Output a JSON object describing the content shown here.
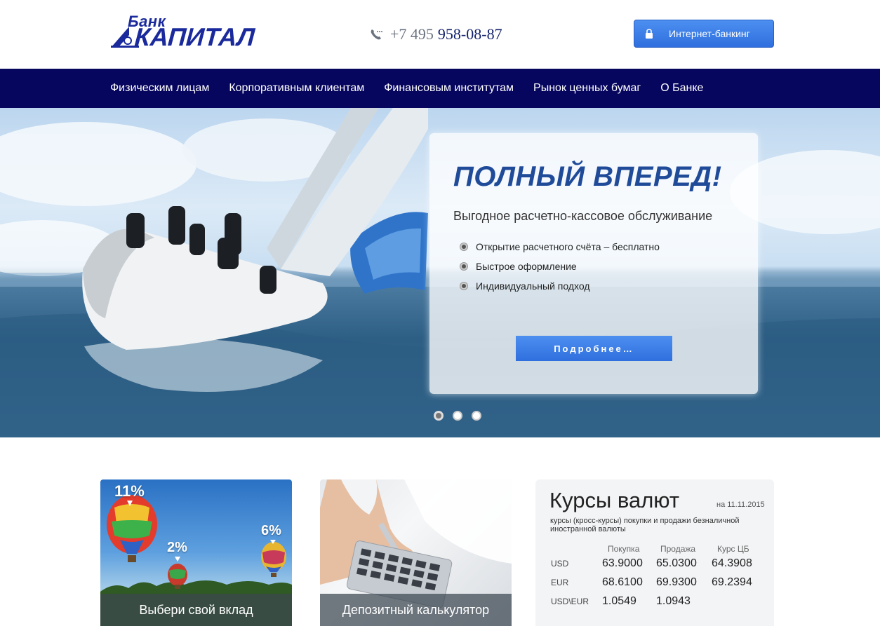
{
  "header": {
    "logo_top": "Банк",
    "logo_main": "КАПИТАЛ",
    "phone_code": "+7 495",
    "phone_number": "958-08-87",
    "internet_banking_label": "Интернет-банкинг"
  },
  "nav": {
    "items": [
      "Физическим лицам",
      "Корпоративным клиентам",
      "Финансовым институтам",
      "Рынок ценных бумаг",
      "О Банке"
    ]
  },
  "promo": {
    "title": "ПОЛНЫЙ ВПЕРЕД!",
    "subtitle": "Выгодное расчетно-кассовое обслуживание",
    "bullets": [
      "Открытие расчетного счёта – бесплатно",
      "Быстрое оформление",
      "Индивидуальный подход"
    ],
    "button_label": "Подробнее…"
  },
  "slider": {
    "count": 3,
    "active_index": 0
  },
  "cards": [
    {
      "caption": "Выбери свой вклад",
      "badges": [
        "11%",
        "2%",
        "6%"
      ]
    },
    {
      "caption": "Депозитный калькулятор"
    }
  ],
  "rates": {
    "title": "Курсы валют",
    "date": "на 11.11.2015",
    "description": "курсы (кросс-курсы) покупки и продажи безналичной иностранной валюты",
    "columns": [
      "Покупка",
      "Продажа",
      "Курс ЦБ"
    ],
    "rows": [
      {
        "currency": "USD",
        "buy": "63.9000",
        "sell": "65.0300",
        "cb": "64.3908"
      },
      {
        "currency": "EUR",
        "buy": "68.6100",
        "sell": "69.9300",
        "cb": "69.2394"
      },
      {
        "currency": "USD\\EUR",
        "buy": "1.0549",
        "sell": "1.0943",
        "cb": ""
      }
    ]
  },
  "colors": {
    "brand_blue": "#1a2a9c",
    "nav_bg": "#07065e",
    "button_blue": "#3a7de6"
  }
}
